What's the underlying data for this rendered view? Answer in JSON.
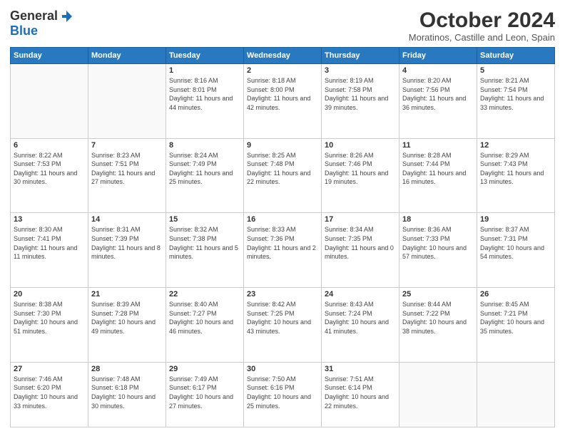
{
  "logo": {
    "general": "General",
    "blue": "Blue"
  },
  "header": {
    "month": "October 2024",
    "location": "Moratinos, Castille and Leon, Spain"
  },
  "days_of_week": [
    "Sunday",
    "Monday",
    "Tuesday",
    "Wednesday",
    "Thursday",
    "Friday",
    "Saturday"
  ],
  "weeks": [
    [
      {
        "day": "",
        "info": ""
      },
      {
        "day": "",
        "info": ""
      },
      {
        "day": "1",
        "info": "Sunrise: 8:16 AM\nSunset: 8:01 PM\nDaylight: 11 hours and 44 minutes."
      },
      {
        "day": "2",
        "info": "Sunrise: 8:18 AM\nSunset: 8:00 PM\nDaylight: 11 hours and 42 minutes."
      },
      {
        "day": "3",
        "info": "Sunrise: 8:19 AM\nSunset: 7:58 PM\nDaylight: 11 hours and 39 minutes."
      },
      {
        "day": "4",
        "info": "Sunrise: 8:20 AM\nSunset: 7:56 PM\nDaylight: 11 hours and 36 minutes."
      },
      {
        "day": "5",
        "info": "Sunrise: 8:21 AM\nSunset: 7:54 PM\nDaylight: 11 hours and 33 minutes."
      }
    ],
    [
      {
        "day": "6",
        "info": "Sunrise: 8:22 AM\nSunset: 7:53 PM\nDaylight: 11 hours and 30 minutes."
      },
      {
        "day": "7",
        "info": "Sunrise: 8:23 AM\nSunset: 7:51 PM\nDaylight: 11 hours and 27 minutes."
      },
      {
        "day": "8",
        "info": "Sunrise: 8:24 AM\nSunset: 7:49 PM\nDaylight: 11 hours and 25 minutes."
      },
      {
        "day": "9",
        "info": "Sunrise: 8:25 AM\nSunset: 7:48 PM\nDaylight: 11 hours and 22 minutes."
      },
      {
        "day": "10",
        "info": "Sunrise: 8:26 AM\nSunset: 7:46 PM\nDaylight: 11 hours and 19 minutes."
      },
      {
        "day": "11",
        "info": "Sunrise: 8:28 AM\nSunset: 7:44 PM\nDaylight: 11 hours and 16 minutes."
      },
      {
        "day": "12",
        "info": "Sunrise: 8:29 AM\nSunset: 7:43 PM\nDaylight: 11 hours and 13 minutes."
      }
    ],
    [
      {
        "day": "13",
        "info": "Sunrise: 8:30 AM\nSunset: 7:41 PM\nDaylight: 11 hours and 11 minutes."
      },
      {
        "day": "14",
        "info": "Sunrise: 8:31 AM\nSunset: 7:39 PM\nDaylight: 11 hours and 8 minutes."
      },
      {
        "day": "15",
        "info": "Sunrise: 8:32 AM\nSunset: 7:38 PM\nDaylight: 11 hours and 5 minutes."
      },
      {
        "day": "16",
        "info": "Sunrise: 8:33 AM\nSunset: 7:36 PM\nDaylight: 11 hours and 2 minutes."
      },
      {
        "day": "17",
        "info": "Sunrise: 8:34 AM\nSunset: 7:35 PM\nDaylight: 11 hours and 0 minutes."
      },
      {
        "day": "18",
        "info": "Sunrise: 8:36 AM\nSunset: 7:33 PM\nDaylight: 10 hours and 57 minutes."
      },
      {
        "day": "19",
        "info": "Sunrise: 8:37 AM\nSunset: 7:31 PM\nDaylight: 10 hours and 54 minutes."
      }
    ],
    [
      {
        "day": "20",
        "info": "Sunrise: 8:38 AM\nSunset: 7:30 PM\nDaylight: 10 hours and 51 minutes."
      },
      {
        "day": "21",
        "info": "Sunrise: 8:39 AM\nSunset: 7:28 PM\nDaylight: 10 hours and 49 minutes."
      },
      {
        "day": "22",
        "info": "Sunrise: 8:40 AM\nSunset: 7:27 PM\nDaylight: 10 hours and 46 minutes."
      },
      {
        "day": "23",
        "info": "Sunrise: 8:42 AM\nSunset: 7:25 PM\nDaylight: 10 hours and 43 minutes."
      },
      {
        "day": "24",
        "info": "Sunrise: 8:43 AM\nSunset: 7:24 PM\nDaylight: 10 hours and 41 minutes."
      },
      {
        "day": "25",
        "info": "Sunrise: 8:44 AM\nSunset: 7:22 PM\nDaylight: 10 hours and 38 minutes."
      },
      {
        "day": "26",
        "info": "Sunrise: 8:45 AM\nSunset: 7:21 PM\nDaylight: 10 hours and 35 minutes."
      }
    ],
    [
      {
        "day": "27",
        "info": "Sunrise: 7:46 AM\nSunset: 6:20 PM\nDaylight: 10 hours and 33 minutes."
      },
      {
        "day": "28",
        "info": "Sunrise: 7:48 AM\nSunset: 6:18 PM\nDaylight: 10 hours and 30 minutes."
      },
      {
        "day": "29",
        "info": "Sunrise: 7:49 AM\nSunset: 6:17 PM\nDaylight: 10 hours and 27 minutes."
      },
      {
        "day": "30",
        "info": "Sunrise: 7:50 AM\nSunset: 6:16 PM\nDaylight: 10 hours and 25 minutes."
      },
      {
        "day": "31",
        "info": "Sunrise: 7:51 AM\nSunset: 6:14 PM\nDaylight: 10 hours and 22 minutes."
      },
      {
        "day": "",
        "info": ""
      },
      {
        "day": "",
        "info": ""
      }
    ]
  ]
}
